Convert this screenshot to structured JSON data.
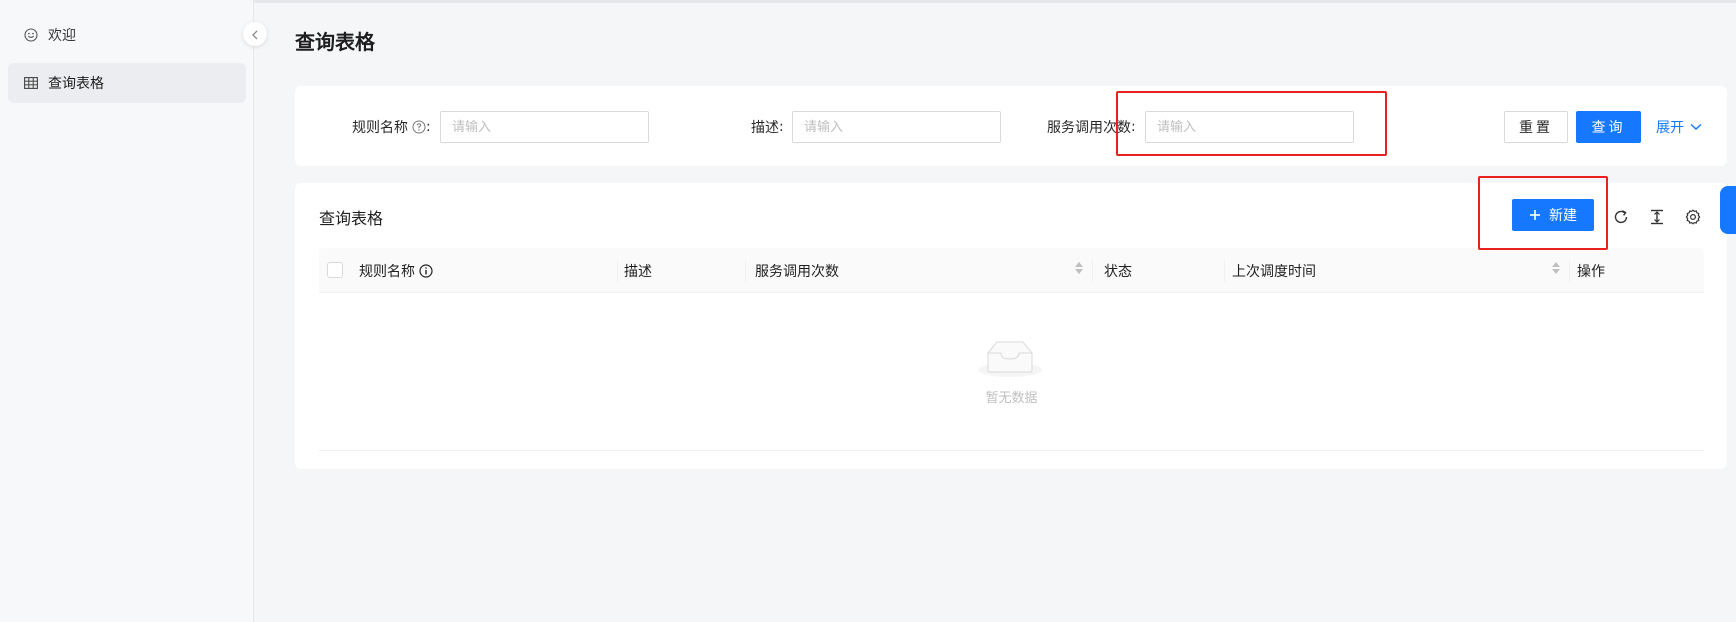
{
  "sidebar": {
    "items": [
      {
        "label": "欢迎",
        "icon": "smile-icon"
      },
      {
        "label": "查询表格",
        "icon": "table-icon"
      }
    ]
  },
  "page": {
    "title": "查询表格"
  },
  "search": {
    "fields": [
      {
        "label": "规则名称",
        "placeholder": "请输入"
      },
      {
        "label": "描述",
        "placeholder": "请输入"
      },
      {
        "label": "服务调用次数",
        "placeholder": "请输入"
      }
    ],
    "reset_label": "重置",
    "query_label": "查询",
    "expand_label": "展开"
  },
  "table": {
    "title": "查询表格",
    "new_label": "新建",
    "columns": [
      "规则名称",
      "描述",
      "服务调用次数",
      "状态",
      "上次调度时间",
      "操作"
    ],
    "empty_text": "暂无数据"
  },
  "colors": {
    "primary": "#1677ff",
    "highlight": "#e8211e"
  }
}
